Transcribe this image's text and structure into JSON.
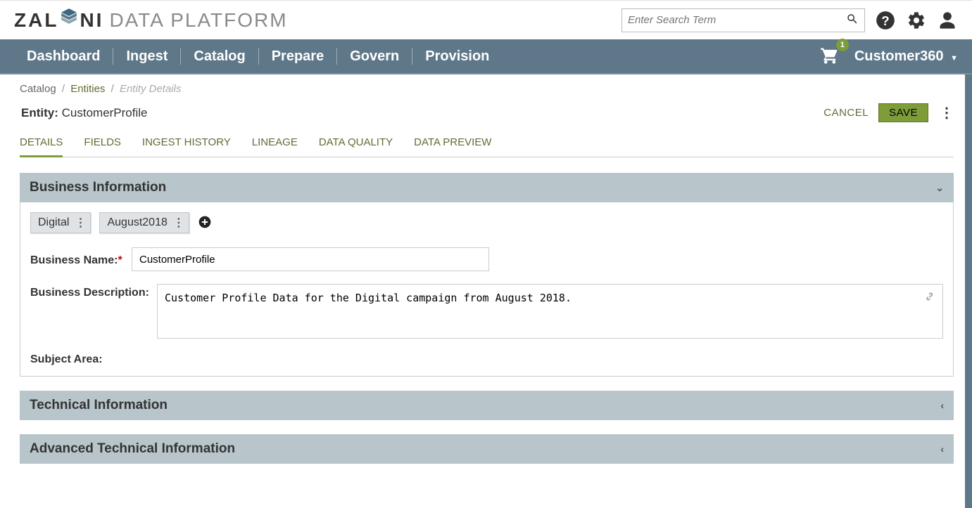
{
  "header": {
    "logo_main": "ZAL",
    "logo_main2": "NI",
    "logo_sub": "DATA PLATFORM",
    "search_placeholder": "Enter Search Term"
  },
  "nav": {
    "items": [
      "Dashboard",
      "Ingest",
      "Catalog",
      "Prepare",
      "Govern",
      "Provision"
    ],
    "cart_count": "1",
    "user": "Customer360"
  },
  "breadcrumb": {
    "root": "Catalog",
    "mid": "Entities",
    "current": "Entity Details"
  },
  "entity": {
    "label": "Entity:",
    "name": "CustomerProfile"
  },
  "actions": {
    "cancel": "CANCEL",
    "save": "SAVE"
  },
  "tabs": [
    "DETAILS",
    "FIELDS",
    "INGEST HISTORY",
    "LINEAGE",
    "DATA QUALITY",
    "DATA PREVIEW"
  ],
  "panels": {
    "business": {
      "title": "Business Information",
      "tags": [
        "Digital",
        "August2018"
      ],
      "name_label": "Business Name:",
      "name_value": "CustomerProfile",
      "desc_label": "Business Description:",
      "desc_value": "Customer Profile Data for the Digital campaign from August 2018.",
      "subject_label": "Subject Area:"
    },
    "technical": {
      "title": "Technical Information"
    },
    "advanced": {
      "title": "Advanced Technical Information"
    }
  }
}
